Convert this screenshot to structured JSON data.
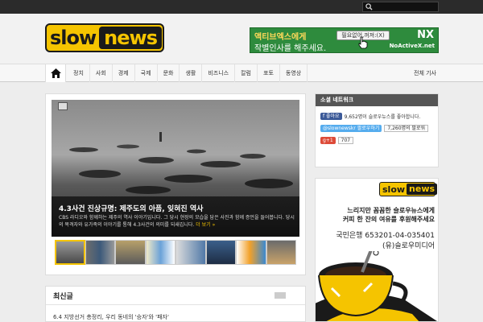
{
  "topbar": {
    "search_placeholder": ""
  },
  "header": {
    "logo_slow": "slow",
    "logo_news": "news"
  },
  "banner": {
    "line1": "액티브엑스에게",
    "line2": "작별인사를 해주세요.",
    "button": "필요없어,꺼져:(X)",
    "brand": "NX",
    "brand_sub": "NoActiveX.net"
  },
  "nav": {
    "items": [
      "정치",
      "사회",
      "경제",
      "국제",
      "문화",
      "생활",
      "비즈니스",
      "칼럼",
      "포토",
      "동영상"
    ],
    "right": "전체 기사"
  },
  "slide": {
    "title": "4.3사건 진상규명: 제주도의 아픔, 잊혀진 역사",
    "desc": "CBS 라디오와 함께하는 제주의 역사 이야기입니다. 그 당시 현장의 모습을 담은 사진과 함께 증언을 들어봅니다. 당시의 목격자와 유가족의 이야기를 통해 4.3사건의 의미를 되새깁니다.",
    "more": "더 보기 »"
  },
  "section2": {
    "title": "최신글",
    "item": "6.4 지방선거 총정리, 우리 동네의 '승자'와 '패자'"
  },
  "widget": {
    "title": "소셜 네트워크",
    "fb_btn": "f 좋아요",
    "fb_text": "9,652명이 슬로우뉴스를 좋아합니다.",
    "tw_btn": "@slownewskr 팔로우하기",
    "tw_count": "7,260명의 팔로워",
    "gp_btn": "g+1",
    "gp_count": "707"
  },
  "ad": {
    "logo_slow": "slow",
    "logo_news": "news",
    "line1": "느리지만 꼼꼼한 슬로우뉴스에게",
    "line2": "커피 한 잔의 여유를 후원해주세요",
    "bank": "국민은행 653201-04-035401",
    "holder": "(유)슬로우미디어"
  },
  "colors": {
    "brand_yellow": "#f5c400",
    "banner_green": "#2e8b3d",
    "dark": "#2b2b2b"
  }
}
